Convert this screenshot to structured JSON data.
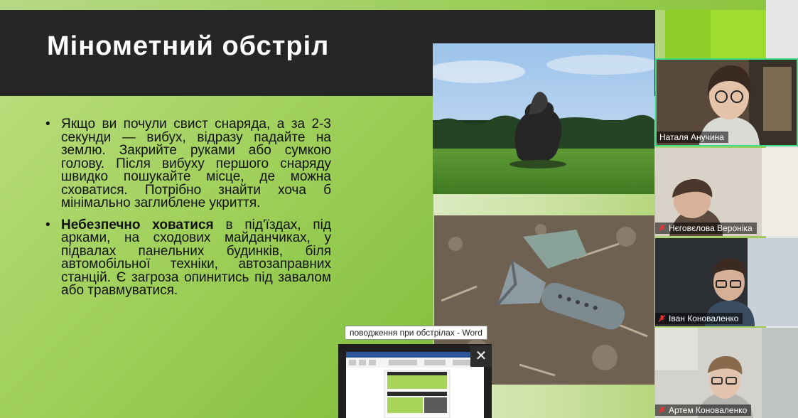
{
  "slide": {
    "title": "Мінометний обстріл",
    "bullet1": "Якщо ви почули свист снаряда, а за 2-3 секунди — вибух, відразу падайте на землю. Закрийте руками або сумкою голову. Після вибуху першого снаряду швидко пошукайте місце, де можна сховатися. Потрібно знайти хоча б мінімально заглиблене укриття.",
    "bullet2_bold": "Небезпечно ховатися",
    "bullet2_rest": " в під'їздах, під арками, на сходових майданчиках, у підвалах панельних будинків, біля автомобільної техніки, автозаправних станцій. Є загроза опинитись під завалом або травмуватися."
  },
  "participants": [
    {
      "name": "Наталя Анучина",
      "muted": false
    },
    {
      "name": "Нєговєлова Вероніка",
      "muted": true
    },
    {
      "name": "Іван Коноваленко",
      "muted": true
    },
    {
      "name": "Артем Коноваленко",
      "muted": true
    }
  ],
  "taskbar_preview": {
    "tooltip": "поводження при обстрілах - Word",
    "close_icon": "close-icon"
  },
  "colors": {
    "accent_green": "#8fcf2a",
    "title_bar": "#262626",
    "active_speaker_border": "#3fdc88",
    "mute_red": "#e53935"
  }
}
